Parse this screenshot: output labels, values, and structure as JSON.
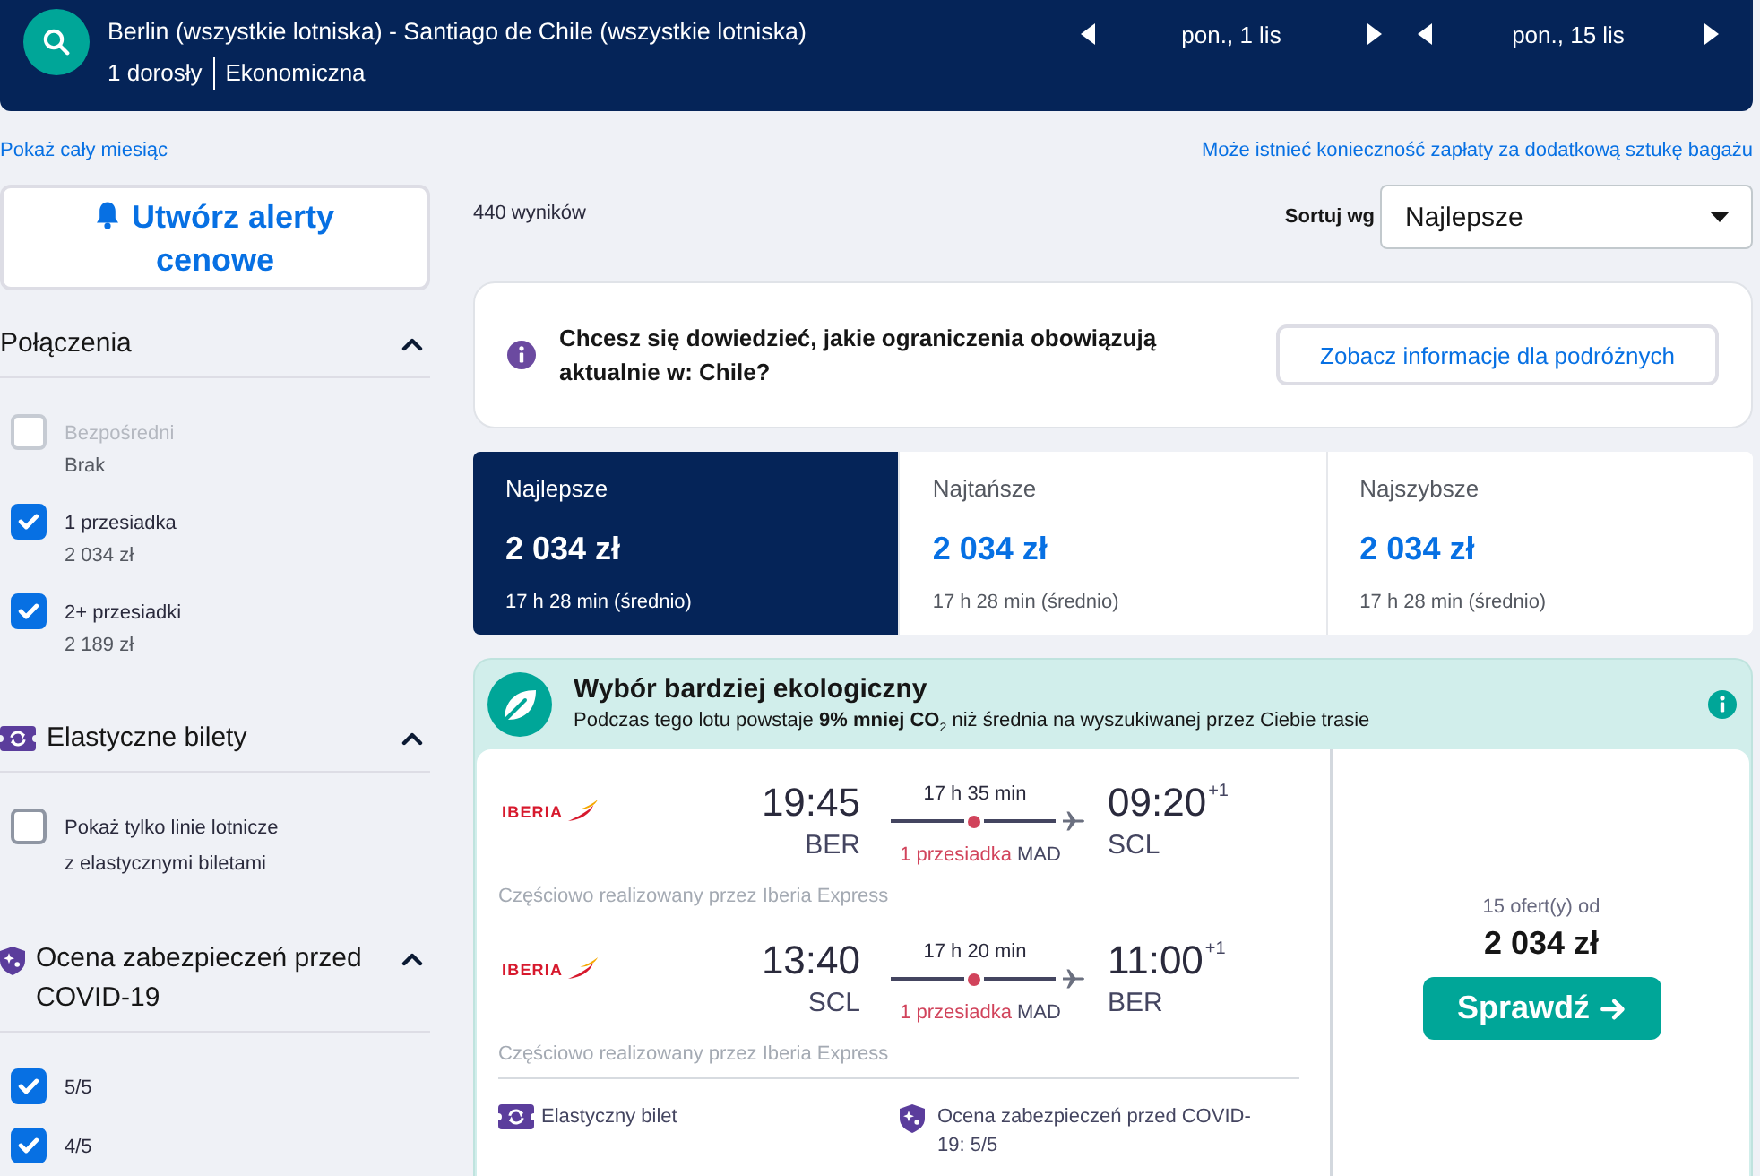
{
  "search_bar": {
    "route": "Berlin (wszystkie lotniska) - Santiago de Chile (wszystkie lotniska)",
    "travellers": "1 dorosły",
    "cabin": "Ekonomiczna",
    "dates": [
      {
        "label": "pon., 1 lis"
      },
      {
        "label": "pon., 15 lis"
      }
    ]
  },
  "links": {
    "month": "Pokaż cały miesiąc",
    "baggage": "Może istnieć konieczność zapłaty za dodatkową sztukę bagażu"
  },
  "sidebar": {
    "alert_button": "Utwórz alerty cenowe",
    "filters": [
      {
        "kind": "plain",
        "title": "Połączenia",
        "expanded": true,
        "options": [
          {
            "label": "Bezpośredni",
            "detail": "Brak",
            "checked": false,
            "disabled": true
          },
          {
            "label": "1 przesiadka",
            "detail": "2 034 zł",
            "checked": true,
            "disabled": false
          },
          {
            "label": "2+ przesiadki",
            "detail": "2 189 zł",
            "checked": true,
            "disabled": false
          }
        ]
      },
      {
        "kind": "flexible",
        "title": "Elastyczne bilety",
        "expanded": true,
        "options": [
          {
            "label": "Pokaż tylko linie lotnicze z elastycznymi biletami",
            "checked": false,
            "disabled": false
          }
        ]
      },
      {
        "kind": "covid",
        "title": "Ocena zabezpieczeń przed COVID-19",
        "expanded": true,
        "options": [
          {
            "label": "5/5",
            "checked": true,
            "disabled": false
          },
          {
            "label": "4/5",
            "checked": true,
            "disabled": false
          }
        ]
      }
    ]
  },
  "results": {
    "count": "440 wyników",
    "sort": {
      "label": "Sortuj wg",
      "value": "Najlepsze"
    },
    "travel_info": {
      "text": "Chcesz się dowiedzieć, jakie ograniczenia obowiązują aktualnie w: Chile?",
      "button": "Zobacz informacje dla podróżnych"
    },
    "sort_tabs": [
      {
        "label": "Najlepsze",
        "price": "2 034 zł",
        "duration": "17 h 28 min (średnio)",
        "selected": true
      },
      {
        "label": "Najtańsze",
        "price": "2 034 zł",
        "duration": "17 h 28 min (średnio)",
        "selected": false
      },
      {
        "label": "Najszybsze",
        "price": "2 034 zł",
        "duration": "17 h 28 min (średnio)",
        "selected": false
      }
    ],
    "result": {
      "eco": {
        "title": "Wybór bardziej ekologiczny",
        "text": "Podczas tego lotu powstaje **9% mniej CO**$_{2}$ niż średnia na wyszukiwanej przez Ciebie trasie"
      },
      "legs": [
        {
          "airline": "IBERIA",
          "depart_time": "19:45",
          "depart_airport": "BER",
          "duration": "17 h 35 min",
          "stops": "1 przesiadka",
          "stop_airport": "MAD",
          "arrive_time": "09:20",
          "day_offset": "+1",
          "arrive_airport": "SCL",
          "operator": "Częściowo realizowany przez Iberia Express"
        },
        {
          "airline": "IBERIA",
          "depart_time": "13:40",
          "depart_airport": "SCL",
          "duration": "17 h 20 min",
          "stops": "1 przesiadka",
          "stop_airport": "MAD",
          "arrive_time": "11:00",
          "day_offset": "+1",
          "arrive_airport": "BER",
          "operator": "Częściowo realizowany przez Iberia Express"
        }
      ],
      "features": [
        {
          "kind": "flexible",
          "label": "Elastyczny bilet"
        },
        {
          "kind": "covid",
          "label": "Ocena zabezpieczeń przed COVID-19: 5/5"
        }
      ],
      "offers": "15 ofert(y) od",
      "price": "2 034 zł",
      "button": "Sprawdź"
    }
  }
}
